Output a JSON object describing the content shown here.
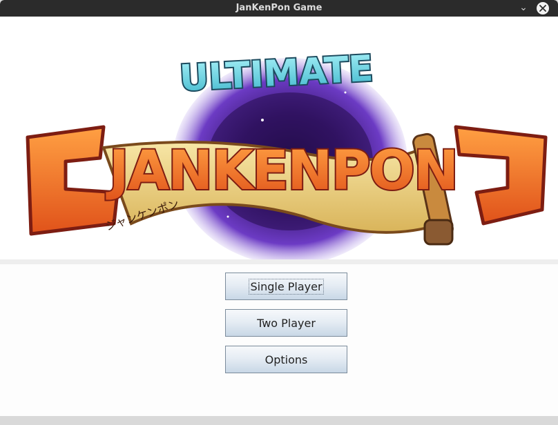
{
  "window": {
    "title": "JanKenPon Game"
  },
  "logo": {
    "top_text": "ULTIMATE",
    "main_text": "JANKENPON",
    "katakana": "ジャンケンポン"
  },
  "menu": {
    "single_player": "Single Player",
    "two_player": "Two Player",
    "options": "Options"
  },
  "colors": {
    "titlebar": "#2b2b2b",
    "button_top": "#f6f8fb",
    "button_bottom": "#c8d7e6",
    "logo_orange": "#ee6a1f",
    "logo_cyan": "#6fd6e4",
    "logo_purple": "#4a1f86"
  }
}
